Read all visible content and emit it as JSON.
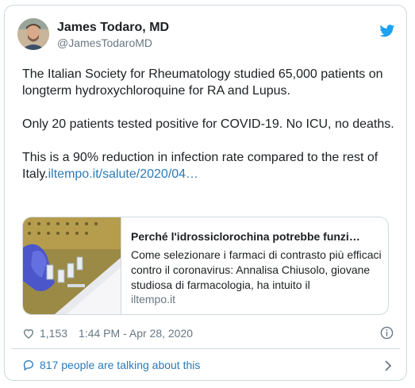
{
  "author": {
    "name": "James Todaro, MD",
    "handle": "@JamesTodaroMD"
  },
  "icons": {
    "brand": "twitter-bird-icon",
    "brand_color": "#1da1f2",
    "like": "heart-icon",
    "info": "info-icon",
    "replies": "speech-bubble-icon",
    "more": "chevron-right-icon"
  },
  "tweet": {
    "paragraph1": "The Italian Society for Rheumatology studied 65,000 patients on longterm hydroxychloroquine for RA and Lupus.",
    "paragraph2": "Only 20 patients tested positive for COVID-19. No ICU, no deaths.",
    "paragraph3": "This is a 90% reduction in infection rate compared to the rest of Italy.",
    "link_text": "iltempo.it/salute/2020/04…"
  },
  "link_card": {
    "title": "Perché l'idrossiclorochina potrebbe funzi…",
    "description": "Come selezionare i farmaci di contrasto più efficaci contro il coronavirus: Annalisa Chiusolo, giovane studiosa di farmacologia, ha intuito il",
    "domain": "iltempo.it"
  },
  "meta": {
    "likes": "1,153",
    "timestamp": "1:44 PM - Apr 28, 2020"
  },
  "footer": {
    "talking": "817 people are talking about this"
  },
  "colors": {
    "link": "#2b7bb9",
    "muted": "#697882",
    "border": "#cfd9de"
  }
}
